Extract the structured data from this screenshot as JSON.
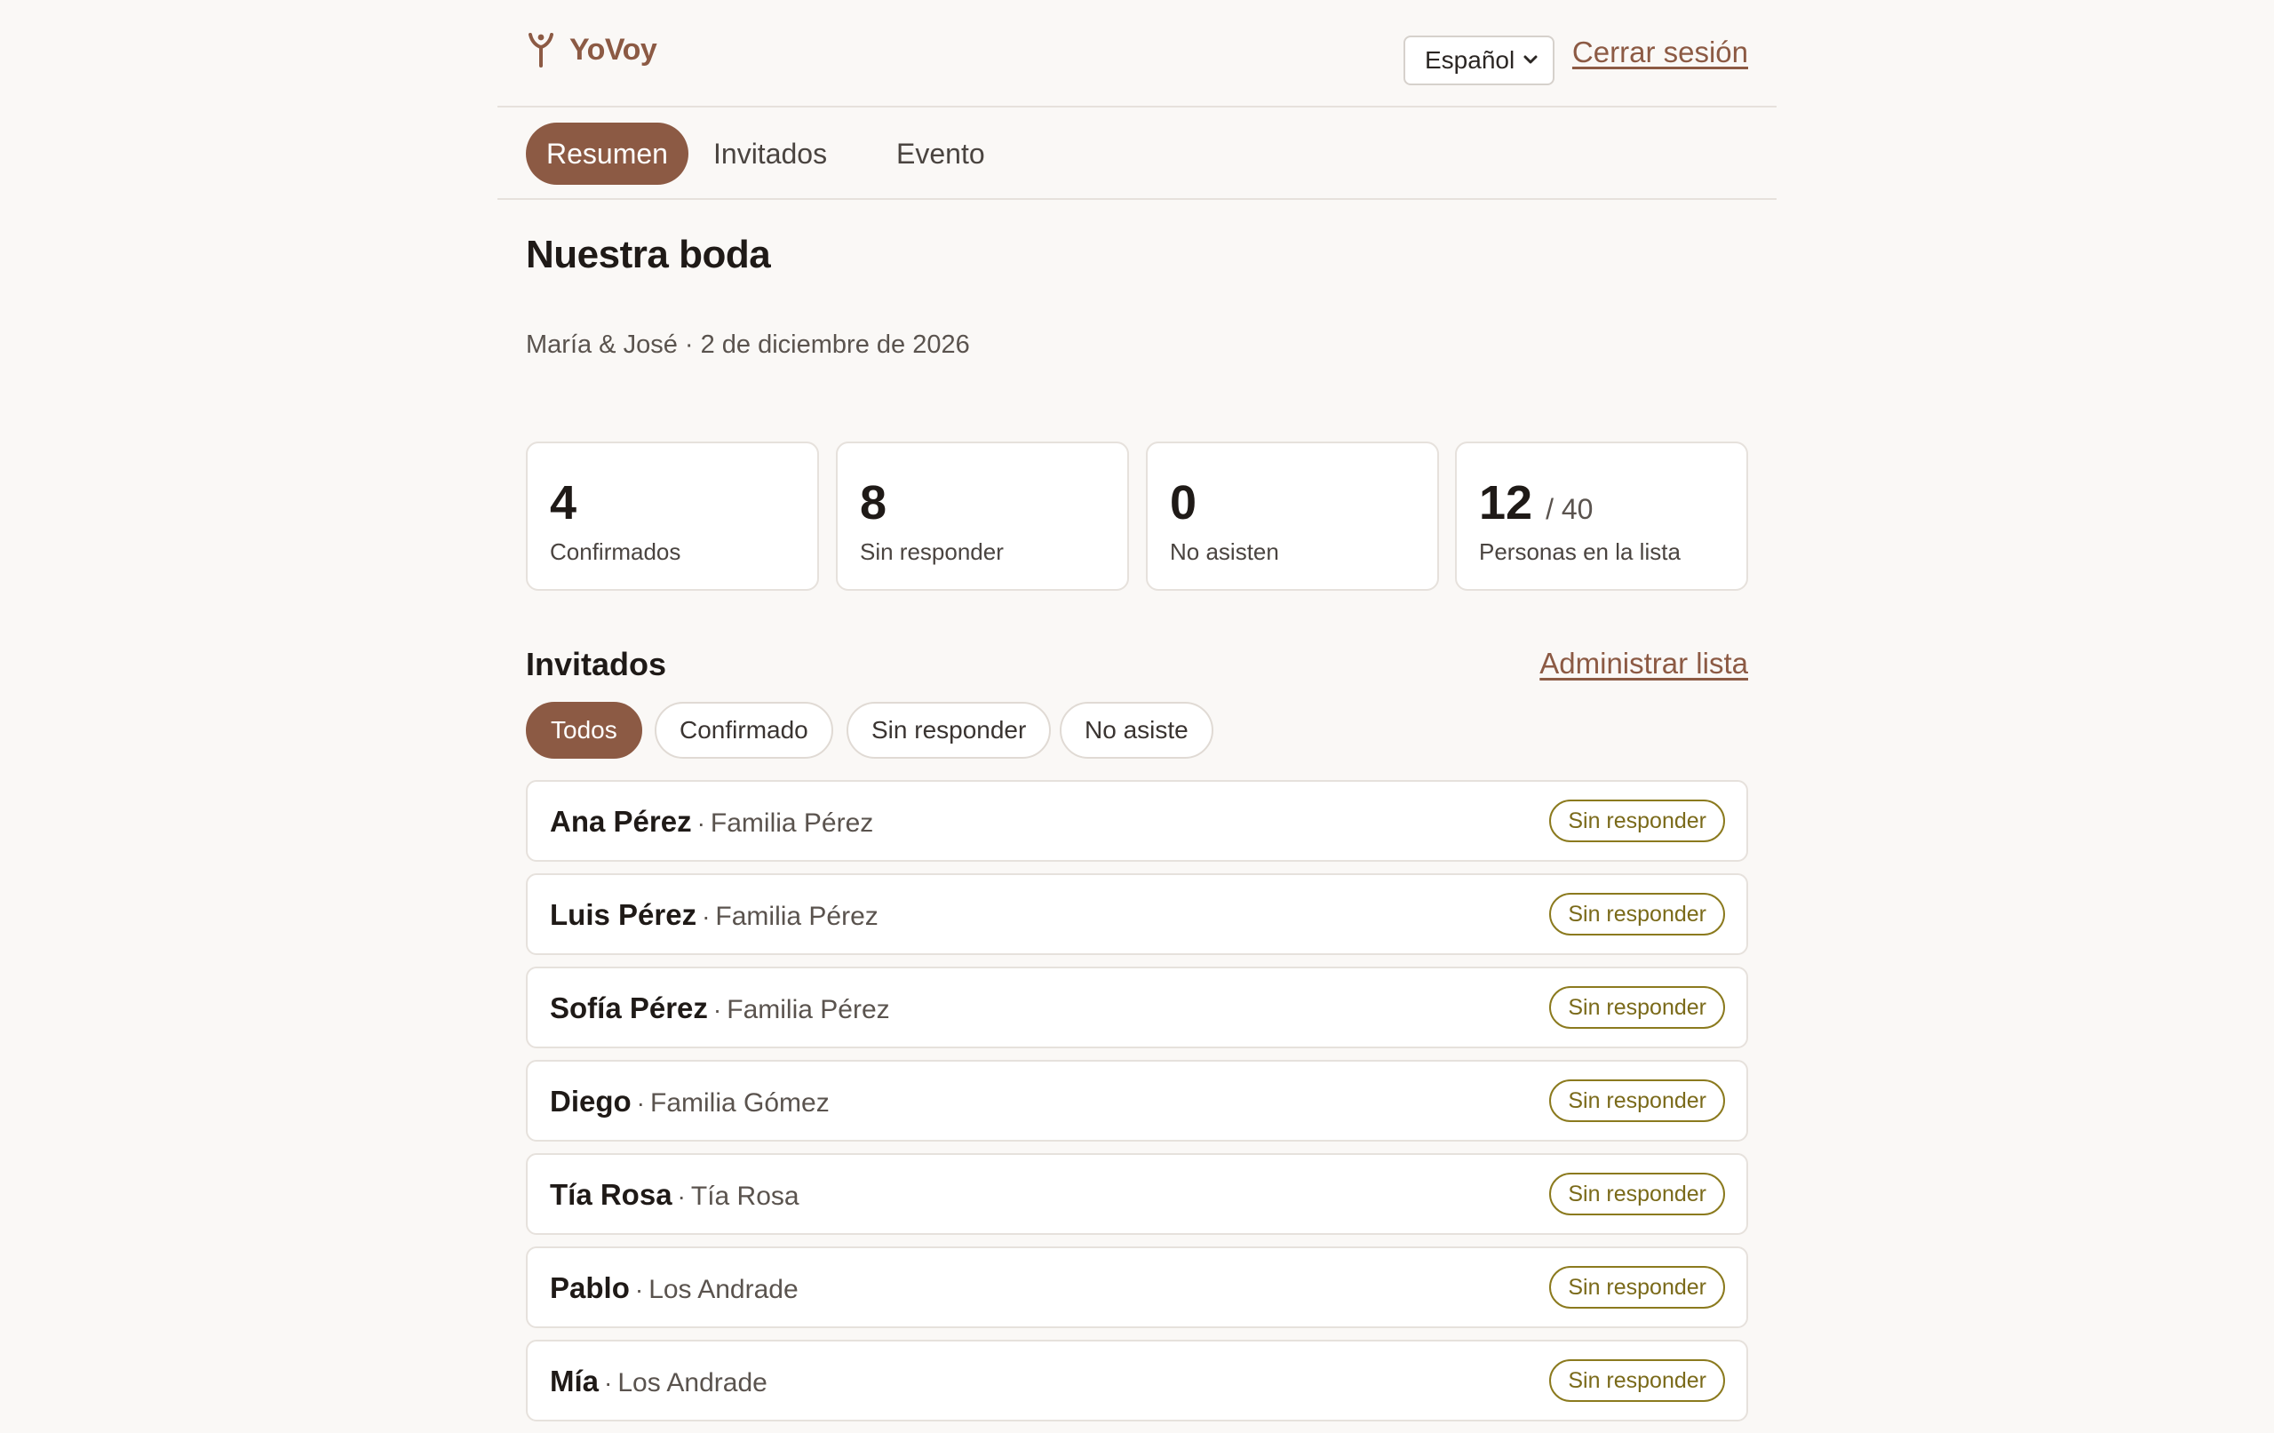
{
  "brand": {
    "name": "YoVoy",
    "icon": "yovoy-logo-icon"
  },
  "header": {
    "language": "Español",
    "logout_label": "Cerrar sesión"
  },
  "tabs": [
    {
      "label": "Resumen",
      "active": true
    },
    {
      "label": "Invitados",
      "active": false
    },
    {
      "label": "Evento",
      "active": false
    }
  ],
  "event": {
    "title": "Nuestra boda",
    "subtitle": "María & José · 2 de diciembre de 2026"
  },
  "stats": [
    {
      "value": "4",
      "label": "Confirmados"
    },
    {
      "value": "8",
      "label": "Sin responder"
    },
    {
      "value": "0",
      "label": "No asisten"
    },
    {
      "value": "12",
      "of": "/ 40",
      "label": "Personas en la lista"
    }
  ],
  "guests": {
    "title": "Invitados",
    "manage_label": "Administrar lista",
    "filters": [
      {
        "label": "Todos",
        "active": true
      },
      {
        "label": "Confirmado",
        "active": false
      },
      {
        "label": "Sin responder",
        "active": false
      },
      {
        "label": "No asiste",
        "active": false
      }
    ],
    "rows": [
      {
        "name": "Ana Pérez",
        "group": "Familia Pérez",
        "status": "Sin responder"
      },
      {
        "name": "Luis Pérez",
        "group": "Familia Pérez",
        "status": "Sin responder"
      },
      {
        "name": "Sofía Pérez",
        "group": "Familia Pérez",
        "status": "Sin responder"
      },
      {
        "name": "Diego",
        "group": "Familia Gómez",
        "status": "Sin responder"
      },
      {
        "name": "Tía Rosa",
        "group": "Tía Rosa",
        "status": "Sin responder"
      },
      {
        "name": "Pablo",
        "group": "Los Andrade",
        "status": "Sin responder"
      },
      {
        "name": "Mía",
        "group": "Los Andrade",
        "status": "Sin responder"
      }
    ]
  },
  "colors": {
    "accent": "#8c5a44",
    "badge": "#7a6a1a",
    "background": "#faf8f6"
  }
}
